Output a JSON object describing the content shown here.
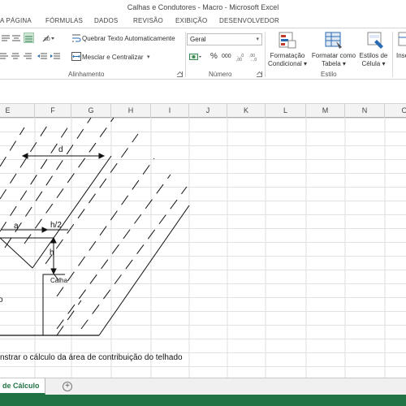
{
  "window": {
    "title": "Calhas e Condutores - Macro - Microsoft Excel"
  },
  "tabs": [
    {
      "label": "A PÁGINA"
    },
    {
      "label": "FÓRMULAS"
    },
    {
      "label": "DADOS"
    },
    {
      "label": "REVISÃO"
    },
    {
      "label": "EXIBIÇÃO"
    },
    {
      "label": "DESENVOLVEDOR"
    }
  ],
  "ribbon": {
    "alignment": {
      "wrap_text": "Quebrar Texto Automaticamente",
      "merge_center": "Mesclar e Centralizar",
      "label": "Alinhamento"
    },
    "number": {
      "format_value": "Geral",
      "percent": "%",
      "thousands": "000",
      "label": "Número"
    },
    "styles": {
      "conditional_line1": "Formatação",
      "conditional_line2": "Condicional",
      "table_line1": "Formatar como",
      "table_line2": "Tabela",
      "cell_styles_line1": "Estilos de",
      "cell_styles_line2": "Célula",
      "label": "Estilo"
    },
    "cells": {
      "insert_partial": "Inse"
    }
  },
  "columns": [
    "E",
    "F",
    "G",
    "H",
    "I",
    "J",
    "K",
    "L",
    "M",
    "N",
    "O"
  ],
  "sheet": {
    "tab_label": "de Cálculo",
    "add_symbol": "+"
  },
  "drawing": {
    "labels": {
      "d": "d",
      "a": "a",
      "h2": "h/2",
      "h": "h",
      "calha": "Calha",
      "partial_left": "o"
    },
    "caption": "nstrar o cálculo da área de contribuição do telhado"
  },
  "colors": {
    "excel_green": "#217346",
    "header_bg": "#f3f3f3",
    "grid_line": "#d4d4d4"
  }
}
